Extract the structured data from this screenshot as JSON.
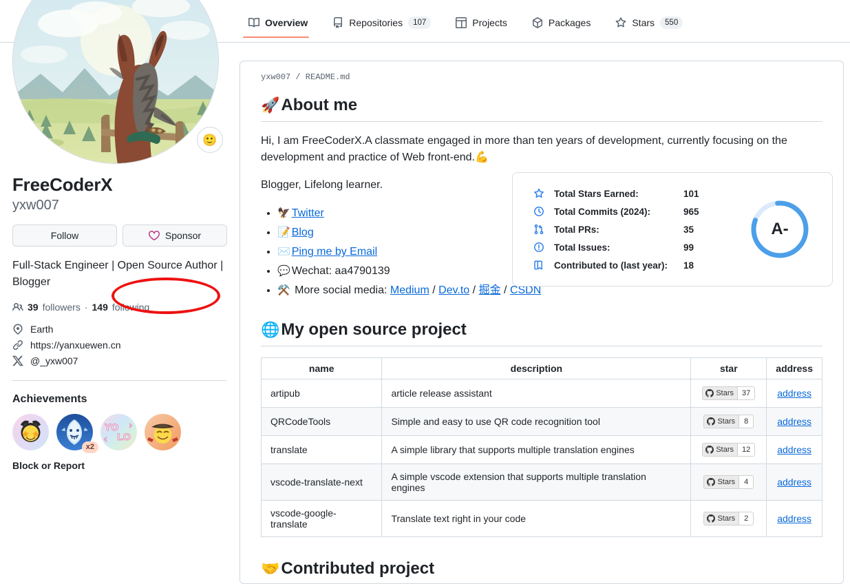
{
  "nav": {
    "tabs": [
      {
        "label": "Overview",
        "icon": "book-icon",
        "count": null,
        "active": true
      },
      {
        "label": "Repositories",
        "icon": "repo-icon",
        "count": "107",
        "active": false
      },
      {
        "label": "Projects",
        "icon": "table-icon",
        "count": null,
        "active": false
      },
      {
        "label": "Packages",
        "icon": "package-icon",
        "count": null,
        "active": false
      },
      {
        "label": "Stars",
        "icon": "star-icon",
        "count": "550",
        "active": false
      }
    ]
  },
  "profile": {
    "avatar_alt": "horse-illustration-avatar",
    "status_emoji": "🙂",
    "fullname": "FreeCoderX",
    "username": "yxw007",
    "follow_label": "Follow",
    "sponsor_label": "Sponsor",
    "bio": "Full-Stack Engineer | Open Source Author | Blogger",
    "followers_count": "39",
    "followers_label": "followers",
    "following_count": "149",
    "following_label": "following",
    "separator": "·",
    "meta": [
      {
        "icon": "location-icon",
        "text": "Earth"
      },
      {
        "icon": "link-icon",
        "text": "https://yanxuewen.cn"
      },
      {
        "icon": "x-twitter-icon",
        "text": "@_yxw007"
      }
    ],
    "achievements_title": "Achievements",
    "achievements": [
      {
        "name": "star-struck-badge",
        "multiplier": null
      },
      {
        "name": "pull-shark-badge",
        "multiplier": "x2"
      },
      {
        "name": "yolo-badge",
        "multiplier": null
      },
      {
        "name": "quickdraw-badge",
        "multiplier": null
      }
    ],
    "block_or_report": "Block or Report"
  },
  "annotation": {
    "target": "sponsor-button",
    "color": "#ee1111"
  },
  "readme": {
    "breadcrumb": "yxw007 / README.md",
    "about": {
      "emoji": "🚀",
      "title": "About me",
      "paragraph1_a": "Hi, I am FreeCoderX.A classmate engaged in more than ten years of development, currently focusing on the development and practice of Web front-end.",
      "paragraph1_emoji": "💪",
      "paragraph2": "Blogger, Lifelong learner.",
      "links": [
        {
          "emoji": "🦅",
          "label": "Twitter",
          "type": "link"
        },
        {
          "emoji": "📝",
          "label": "Blog",
          "type": "link"
        },
        {
          "emoji": "✉️",
          "label": "Ping me by Email",
          "type": "link"
        },
        {
          "emoji": "💬",
          "label_prefix": "Wechat:",
          "value": "aa4790139",
          "type": "text"
        },
        {
          "emoji": "⚒️",
          "label_prefix": "More social media:",
          "type": "multi",
          "items": [
            "Medium",
            "Dev.to",
            "掘金",
            "CSDN"
          ],
          "sep": "/"
        }
      ]
    },
    "stats": {
      "rows": [
        {
          "icon": "star-icon",
          "label": "Total Stars Earned:",
          "value": "101"
        },
        {
          "icon": "history-icon",
          "label": "Total Commits (2024):",
          "value": "965"
        },
        {
          "icon": "pull-request-icon",
          "label": "Total PRs:",
          "value": "35"
        },
        {
          "icon": "issue-icon",
          "label": "Total Issues:",
          "value": "99"
        },
        {
          "icon": "repo-icon",
          "label": "Contributed to (last year):",
          "value": "18"
        }
      ],
      "grade": "A-",
      "ring_color": "#4c9fe8",
      "ring_track_color": "#dceafc",
      "ring_percent": 82
    },
    "projects": {
      "emoji": "🌐",
      "title": "My open source project",
      "columns": [
        "name",
        "description",
        "star",
        "address"
      ],
      "star_badge_label": "Stars",
      "address_label": "address",
      "rows": [
        {
          "name": "artipub",
          "description": "article release assistant",
          "stars": "37"
        },
        {
          "name": "QRCodeTools",
          "description": "Simple and easy to use QR code recognition tool",
          "stars": "8"
        },
        {
          "name": "translate",
          "description": "A simple library that supports multiple translation engines",
          "stars": "12"
        },
        {
          "name": "vscode-translate-next",
          "description": "A simple vscode extension that supports multiple translation engines",
          "stars": "4"
        },
        {
          "name": "vscode-google-translate",
          "description": "Translate text right in your code",
          "stars": "2"
        }
      ]
    },
    "contributed": {
      "emoji": "🤝",
      "title": "Contributed project"
    }
  }
}
